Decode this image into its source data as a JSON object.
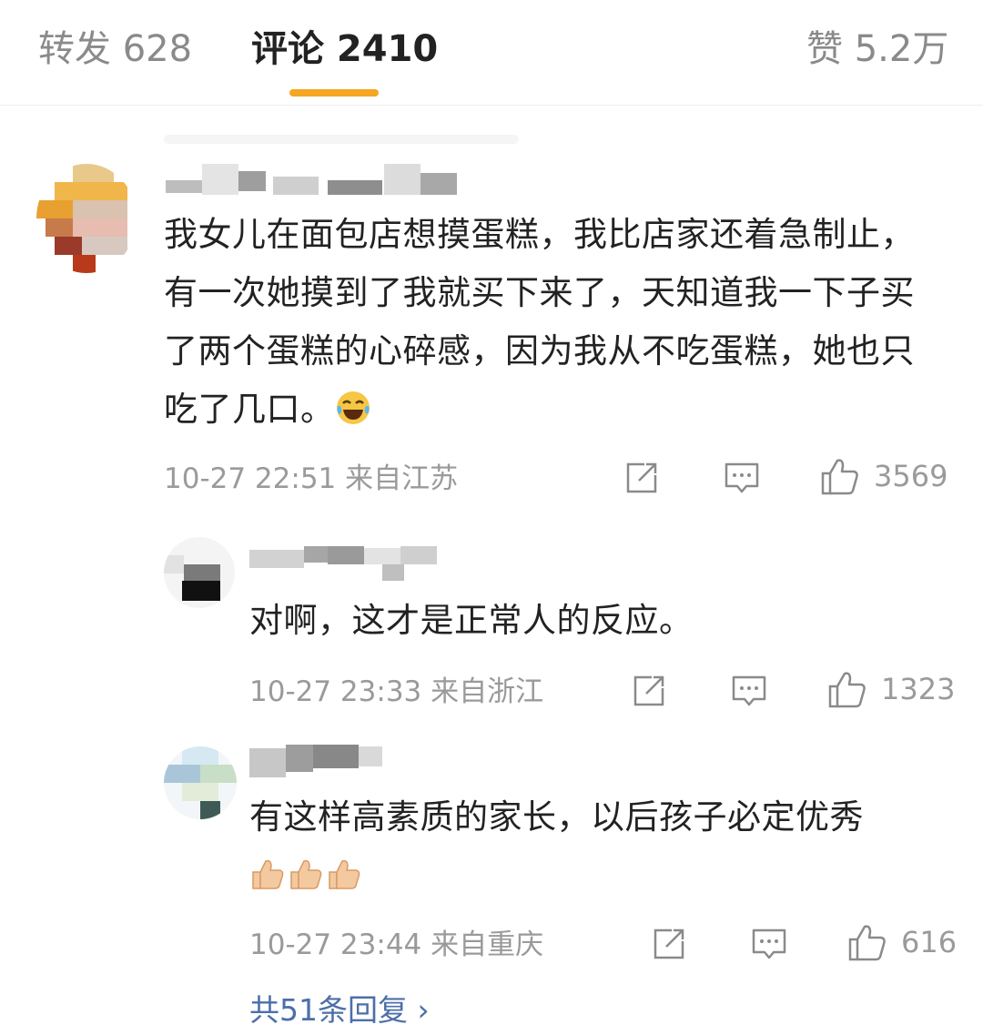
{
  "tabs": [
    {
      "label": "转发 628",
      "active": false
    },
    {
      "label": "评论 2410",
      "active": true
    },
    {
      "label": "赞 5.2万",
      "active": false
    }
  ],
  "accent_color": "#f5a623",
  "link_color": "#4c6fa8",
  "comments": [
    {
      "text": "我女儿在面包店想摸蛋糕，我比店家还着急制止，有一次她摸到了我就买下来了，天知道我一下子买了两个蛋糕的心碎感，因为我从不吃蛋糕，她也只吃了几口。",
      "emoji": "laughing-tears-emoji",
      "meta": "10-27 22:51 来自江苏",
      "likes": "3569"
    },
    {
      "text": "对啊，这才是正常人的反应。",
      "meta": "10-27 23:33 来自浙江",
      "likes": "1323"
    },
    {
      "text": "有这样高素质的家长，以后孩子必定优秀",
      "emoji": "thumbs-up-emoji x3",
      "meta": "10-27 23:44 来自重庆",
      "likes": "616"
    }
  ],
  "replies_link": "共51条回复 ›",
  "icons": [
    "share-icon",
    "comment-icon",
    "like-icon"
  ]
}
